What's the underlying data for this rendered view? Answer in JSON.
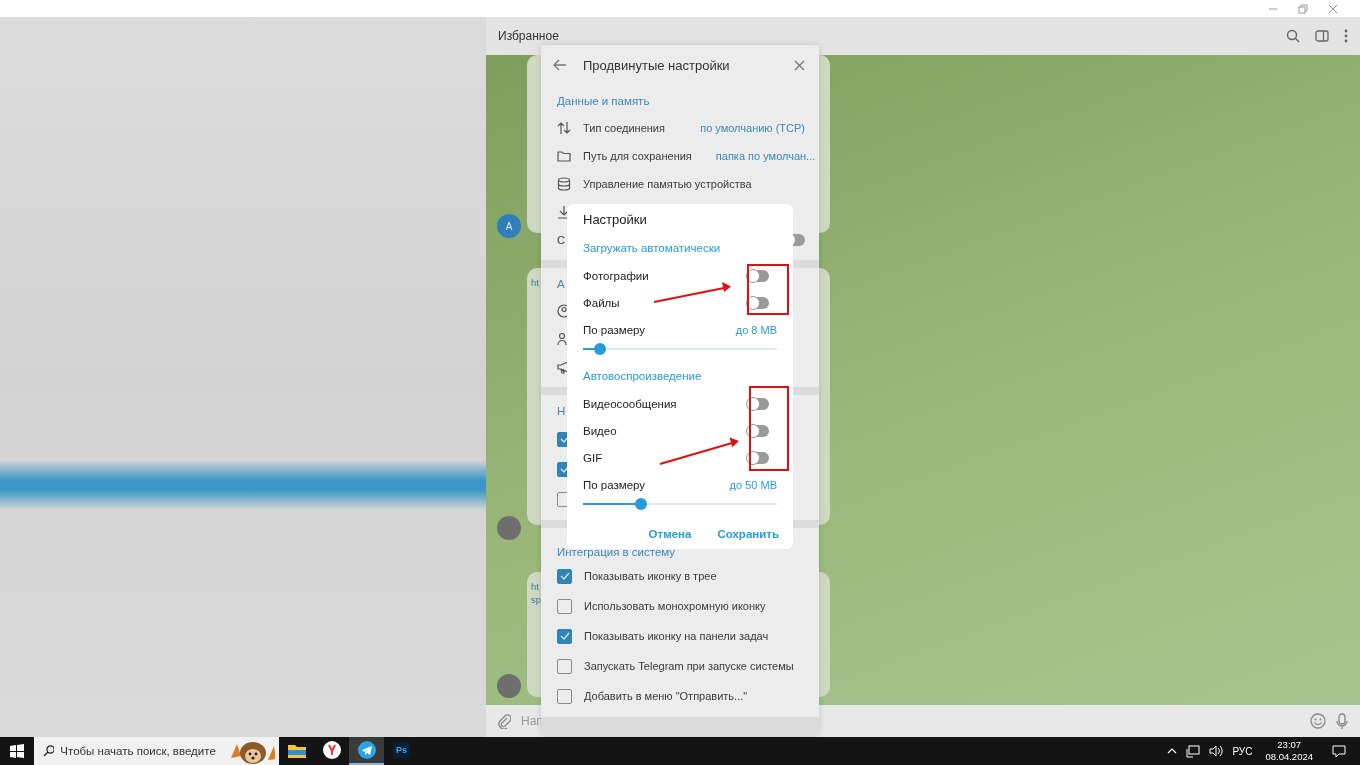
{
  "chat": {
    "title": "Избранное",
    "avatar_letter": "A",
    "bubbles": [
      {
        "lines": [
          "ht"
        ]
      },
      {
        "lines": [
          "ht",
          "sp"
        ]
      }
    ],
    "composer": {
      "placeholder": "Нап"
    }
  },
  "panel": {
    "title": "Продвинутые настройки",
    "sections": [
      {
        "title": "Данные и память",
        "items": [
          {
            "kind": "value",
            "label": "Тип соединения",
            "value": "по умолчанию (TCP)"
          },
          {
            "kind": "value",
            "label": "Путь для сохранения",
            "value": "папка по умолчан..."
          },
          {
            "kind": "value",
            "label": "Управление памятью устройства"
          },
          {
            "kind": "value"
          },
          {
            "kind": "toggle",
            "label": "С",
            "on": false
          }
        ]
      },
      {
        "title": "А",
        "items": [
          {
            "kind": "icon"
          },
          {
            "kind": "icon"
          },
          {
            "kind": "icon"
          }
        ]
      },
      {
        "title": "Н",
        "items": [
          {
            "kind": "checkbox",
            "checked": true
          },
          {
            "kind": "checkbox",
            "checked": true
          },
          {
            "kind": "checkbox",
            "checked": false
          }
        ]
      },
      {
        "title": "Интеграция в систему",
        "items": [
          {
            "kind": "checkbox",
            "label": "Показывать иконку в трее",
            "checked": true
          },
          {
            "kind": "checkbox",
            "label": "Использовать монохромную иконку",
            "checked": false
          },
          {
            "kind": "checkbox",
            "label": "Показывать иконку на панели задач",
            "checked": true
          },
          {
            "kind": "checkbox",
            "label": "Запускать Telegram при запуске системы",
            "checked": false
          },
          {
            "kind": "checkbox",
            "label": "Добавить в меню \"Отправить...\"",
            "checked": false
          }
        ]
      }
    ]
  },
  "dialog": {
    "title": "Настройки",
    "sections": [
      {
        "title": "Загружать автоматически",
        "toggles": [
          {
            "label": "Фотографии",
            "on": false
          },
          {
            "label": "Файлы",
            "on": false
          }
        ],
        "size_label": "По размеру",
        "size_value": "до 8 MB",
        "level": 0.09
      },
      {
        "title": "Автовоспроизведение",
        "toggles": [
          {
            "label": "Видеосообщения",
            "on": false
          },
          {
            "label": "Видео",
            "on": false
          },
          {
            "label": "GIF",
            "on": false
          }
        ],
        "size_label": "По размеру",
        "size_value": "до 50 MB",
        "level": 0.3
      }
    ],
    "buttons": [
      "Отмена",
      "Сохранить"
    ]
  },
  "taskbar": {
    "search_placeholder": "Чтобы начать поиск, введите",
    "apps": [
      {
        "kind": "folder",
        "selected": false
      },
      {
        "kind": "browser",
        "selected": false
      },
      {
        "kind": "telegram",
        "selected": true
      },
      {
        "kind": "ps",
        "selected": false,
        "label": "Ps"
      }
    ],
    "language": "РУС",
    "time": "23:07",
    "date": "08.04.2024"
  }
}
